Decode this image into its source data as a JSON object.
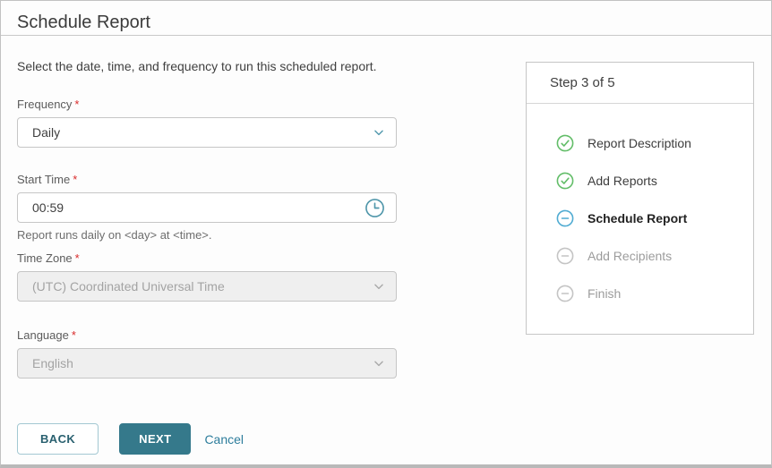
{
  "page": {
    "title": "Schedule Report"
  },
  "form": {
    "intro": "Select the date, time, and frequency to run this scheduled report.",
    "required_marker": "*",
    "fields": {
      "frequency": {
        "label": "Frequency",
        "value": "Daily",
        "disabled": false
      },
      "start_time": {
        "label": "Start Time",
        "value": "00:59",
        "helper": "Report runs daily on <day> at <time>."
      },
      "time_zone": {
        "label": "Time Zone",
        "value": "(UTC) Coordinated Universal Time",
        "disabled": true
      },
      "language": {
        "label": "Language",
        "value": "English",
        "disabled": true
      }
    },
    "buttons": {
      "back": "BACK",
      "next": "NEXT",
      "cancel": "Cancel"
    }
  },
  "wizard": {
    "header": "Step 3 of 5",
    "steps": [
      {
        "label": "Report Description",
        "state": "complete"
      },
      {
        "label": "Add Reports",
        "state": "complete"
      },
      {
        "label": "Schedule Report",
        "state": "current"
      },
      {
        "label": "Add Recipients",
        "state": "pending"
      },
      {
        "label": "Finish",
        "state": "pending"
      }
    ]
  },
  "icons": {
    "frequency_dropdown": "chevron-down",
    "time_zone_dropdown": "chevron-down",
    "language_dropdown": "chevron-down",
    "start_time": "clock",
    "step_complete": "check-circle",
    "step_current": "dash-circle-blue",
    "step_pending": "dash-circle-gray"
  },
  "colors": {
    "accent_teal": "#35798b",
    "link_teal": "#2d7d9c",
    "icon_teal": "#5198ad",
    "step_complete_green": "#62bd68",
    "step_current_blue": "#4fabd2",
    "step_pending_gray": "#c4c4c4",
    "required_red": "#d92b2b",
    "disabled_bg": "#efefef",
    "border_gray": "#c6c6c6"
  }
}
